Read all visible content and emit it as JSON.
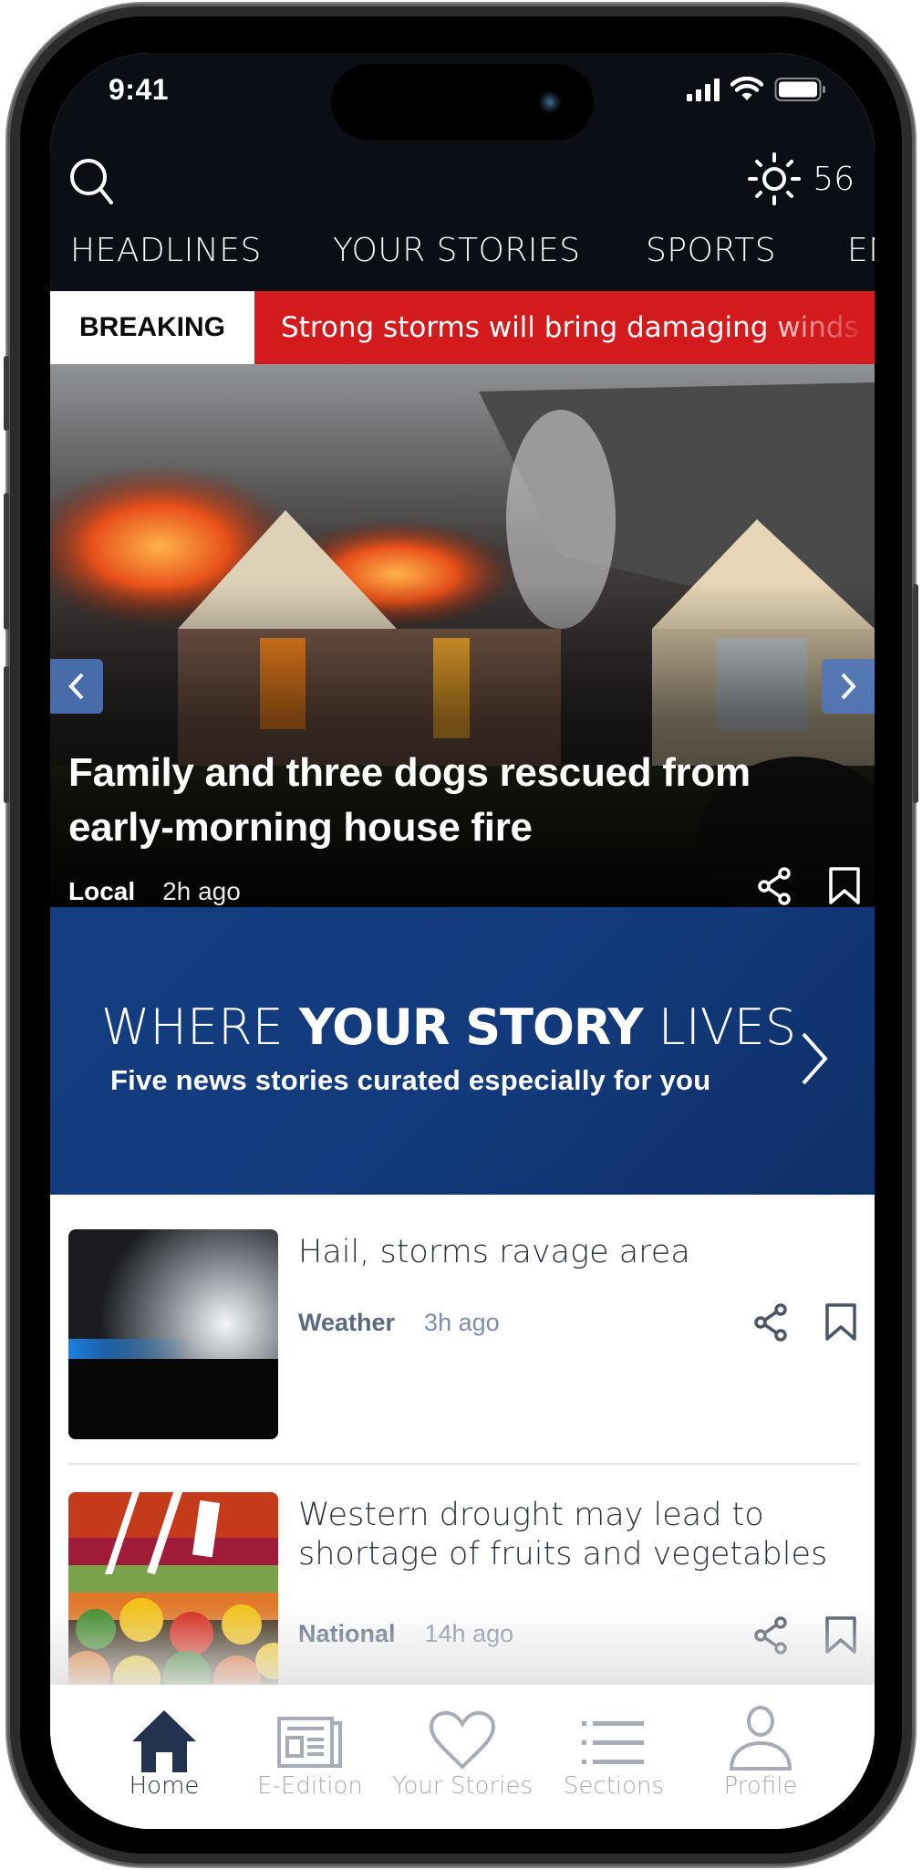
{
  "status_bar": {
    "time": "9:41"
  },
  "header": {
    "search_icon": "search-icon",
    "weather_icon": "sun-icon",
    "temperature": "56"
  },
  "tabs": [
    {
      "label": "HEADLINES"
    },
    {
      "label": "YOUR STORIES"
    },
    {
      "label": "SPORTS"
    },
    {
      "label": "ENTERTAINMENT"
    }
  ],
  "breaking": {
    "label": "BREAKING",
    "text": "Strong storms will bring damaging winds and hail"
  },
  "hero": {
    "title": "Family and three dogs rescued from early-morning house fire",
    "section": "Local",
    "time": "2h ago",
    "prev_icon": "chevron-left-icon",
    "next_icon": "chevron-right-icon"
  },
  "banner": {
    "title_pre": "WHERE ",
    "title_bold": "YOUR STORY",
    "title_post": " LIVES",
    "subtitle": "Five news stories curated especially for you"
  },
  "stories": [
    {
      "title": "Hail, storms ravage area",
      "section": "Weather",
      "time": "3h ago"
    },
    {
      "title": "Western drought may lead to shortage of fruits and vegetables",
      "section": "National",
      "time": "14h ago"
    }
  ],
  "bottom_nav": [
    {
      "label": "Home",
      "icon": "home-icon",
      "active": true
    },
    {
      "label": "E-Edition",
      "icon": "newspaper-icon",
      "active": false
    },
    {
      "label": "Your Stories",
      "icon": "heart-icon",
      "active": false
    },
    {
      "label": "Sections",
      "icon": "list-icon",
      "active": false
    },
    {
      "label": "Profile",
      "icon": "profile-icon",
      "active": false
    }
  ],
  "colors": {
    "header_bg": "#0b0f15",
    "breaking_red": "#d31a1c",
    "banner_blue": "#143e82",
    "nav_active": "#23324e",
    "nav_inactive": "#a6adb8"
  }
}
